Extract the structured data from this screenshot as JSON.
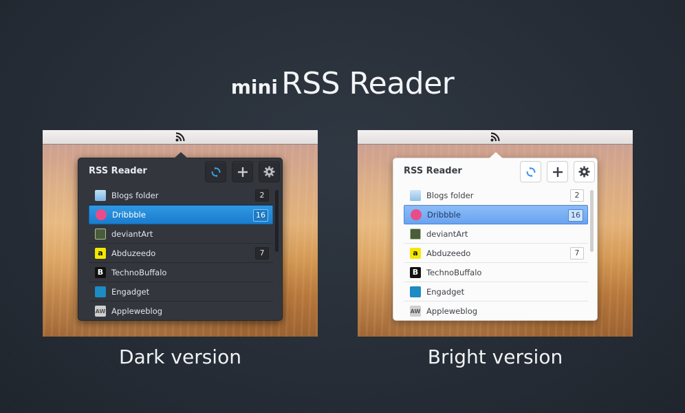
{
  "title": {
    "prefix": "mini",
    "main": "RSS Reader"
  },
  "panels": [
    {
      "theme": "dark",
      "caption": "Dark version",
      "popup_title": "RSS Reader",
      "accent": "#1a7ccd",
      "toolbar": {
        "refresh_icon": "refresh-icon",
        "add_icon": "plus-icon",
        "settings_icon": "gear-icon"
      },
      "feeds": [
        {
          "label": "Blogs folder",
          "count": "2",
          "icon": "folder-icon"
        },
        {
          "label": "Dribbble",
          "count": "16",
          "icon": "dribbble-icon",
          "selected": true
        },
        {
          "label": "deviantArt",
          "count": "",
          "icon": "deviantart-icon"
        },
        {
          "label": "Abduzeedo",
          "count": "7",
          "icon": "abduzeedo-icon"
        },
        {
          "label": "TechnoBuffalo",
          "count": "",
          "icon": "technobuffalo-icon"
        },
        {
          "label": "Engadget",
          "count": "",
          "icon": "engadget-icon"
        },
        {
          "label": "Appleweblog",
          "count": "",
          "icon": "appleweblog-icon"
        }
      ]
    },
    {
      "theme": "bright",
      "caption": "Bright version",
      "popup_title": "RSS Reader",
      "accent": "#6aa3ef",
      "toolbar": {
        "refresh_icon": "refresh-icon",
        "add_icon": "plus-icon",
        "settings_icon": "gear-icon"
      },
      "feeds": [
        {
          "label": "Blogs folder",
          "count": "2",
          "icon": "folder-icon"
        },
        {
          "label": "Dribbble",
          "count": "16",
          "icon": "dribbble-icon",
          "selected": true
        },
        {
          "label": "deviantArt",
          "count": "",
          "icon": "deviantart-icon"
        },
        {
          "label": "Abduzeedo",
          "count": "7",
          "icon": "abduzeedo-icon"
        },
        {
          "label": "TechnoBuffalo",
          "count": "",
          "icon": "technobuffalo-icon"
        },
        {
          "label": "Engadget",
          "count": "",
          "icon": "engadget-icon"
        },
        {
          "label": "Appleweblog",
          "count": "",
          "icon": "appleweblog-icon"
        }
      ]
    }
  ]
}
